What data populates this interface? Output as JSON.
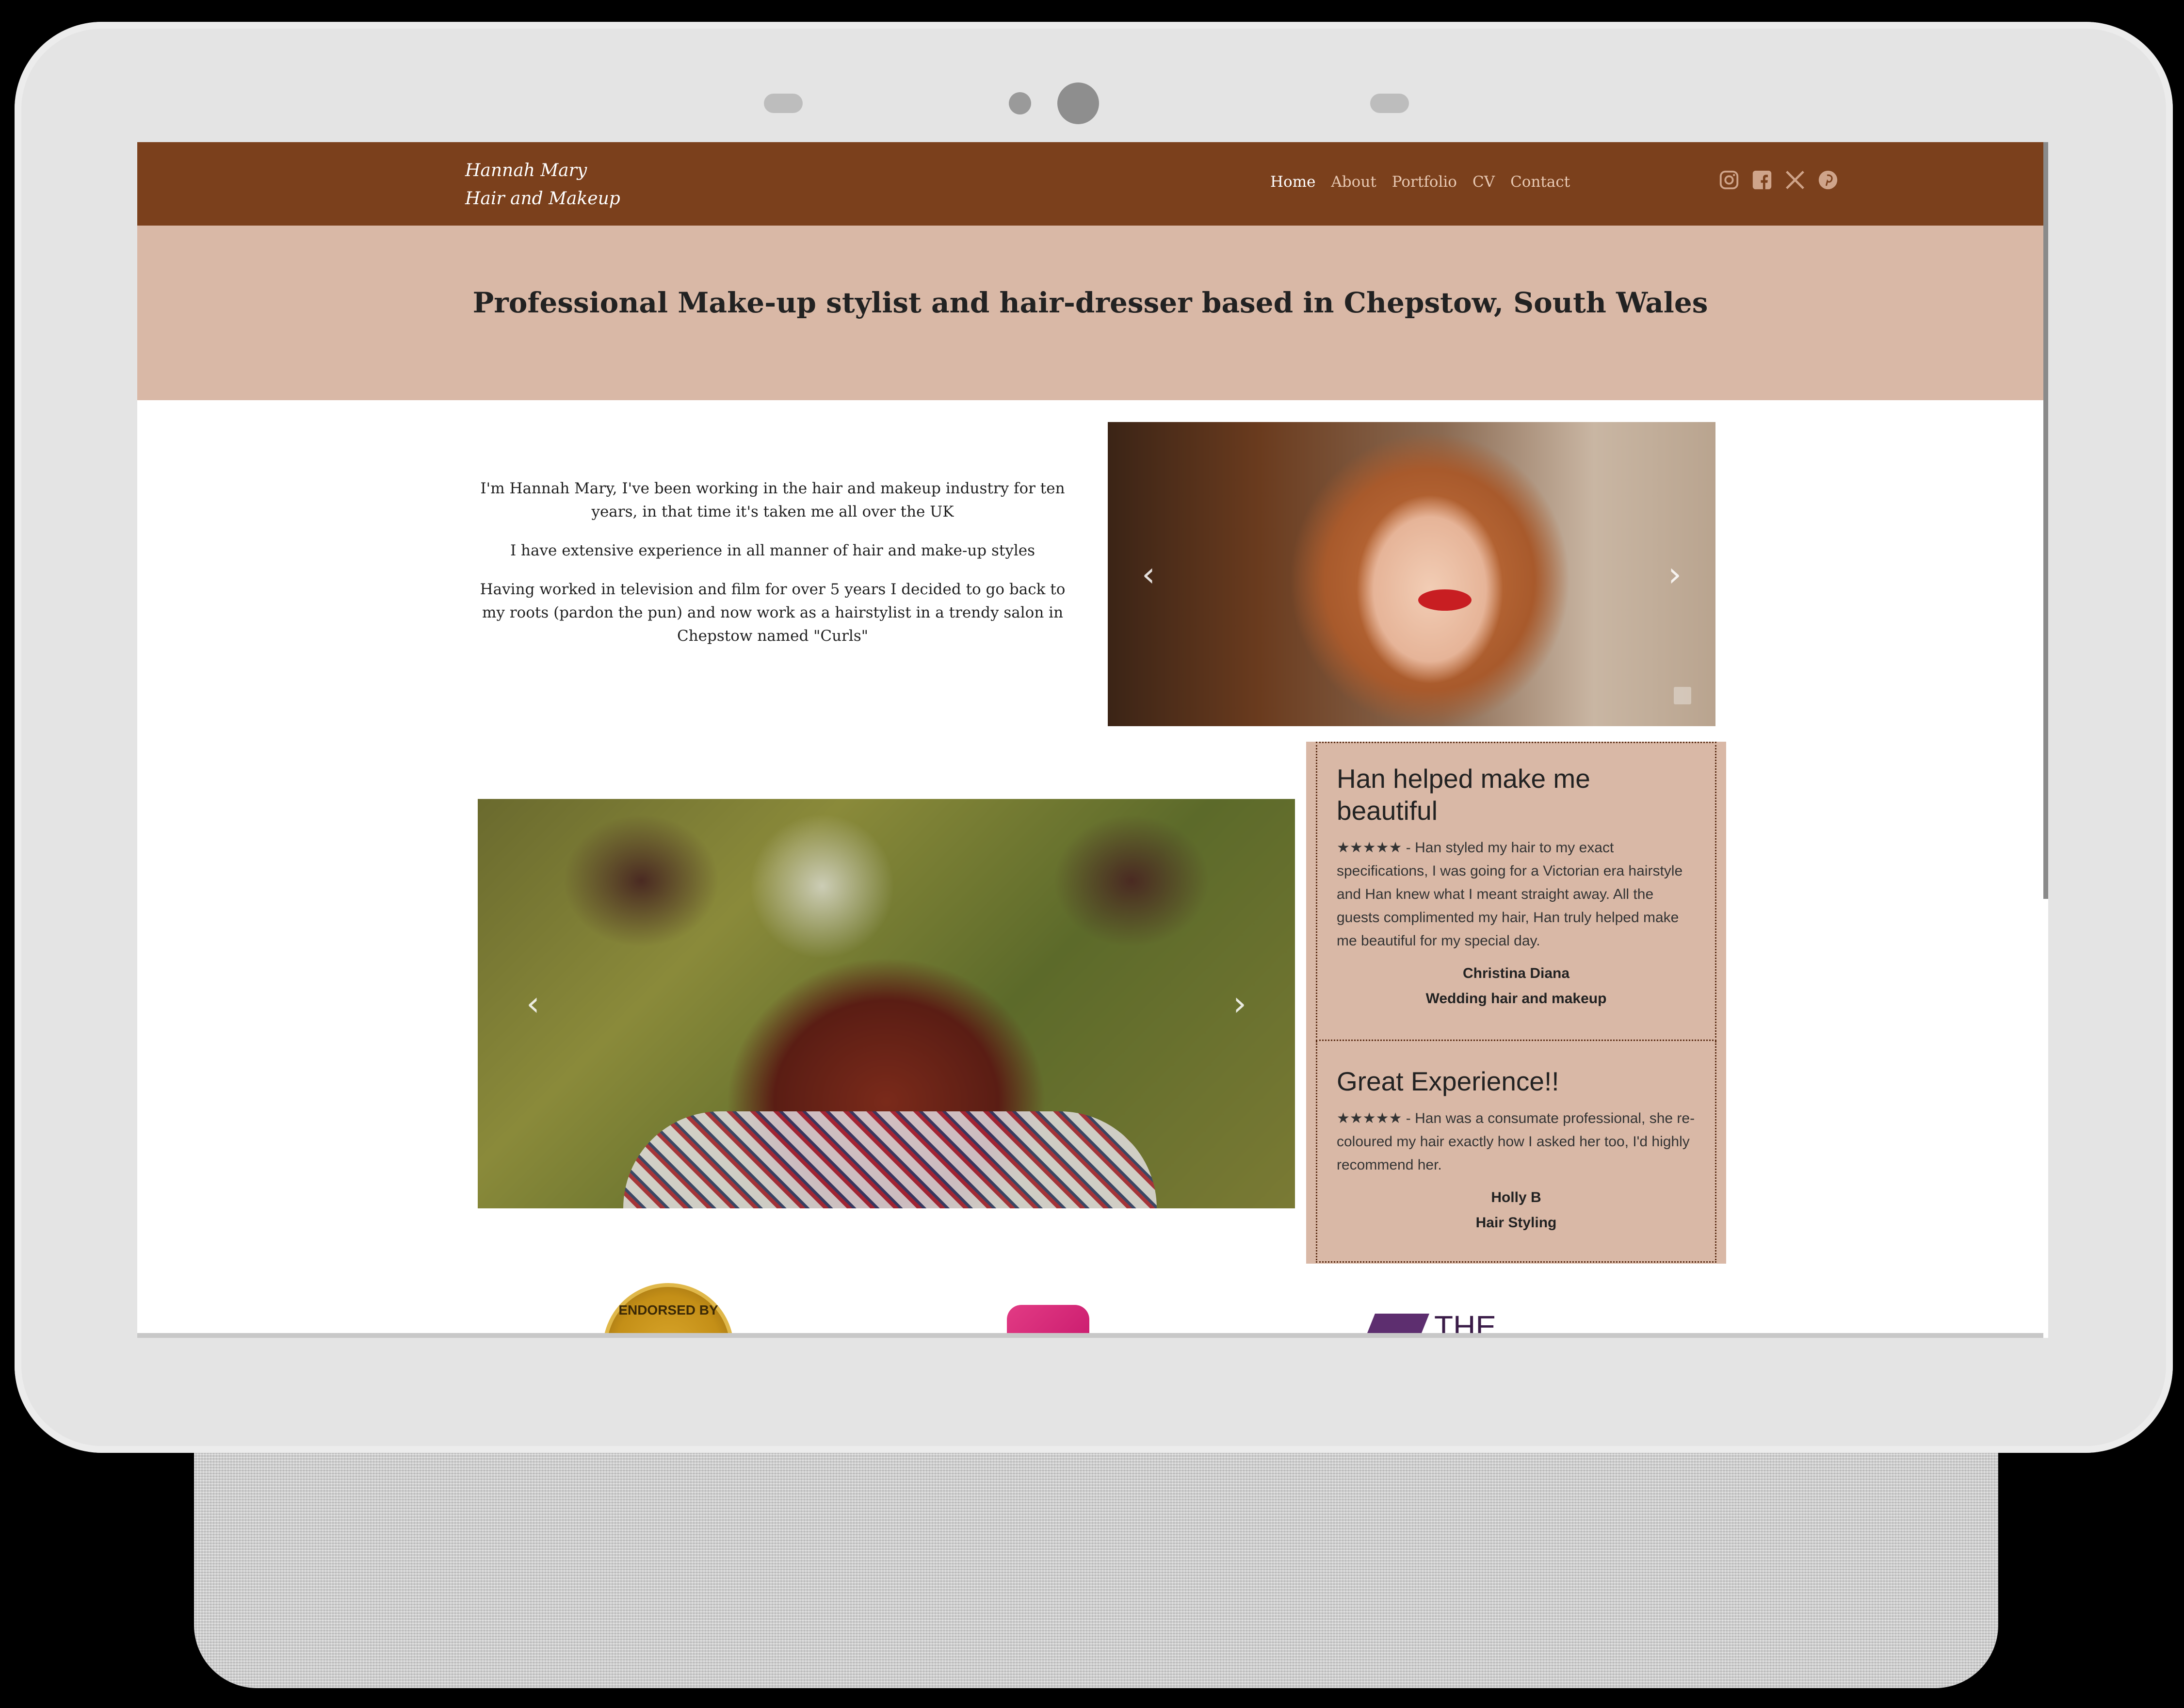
{
  "brand": {
    "line1": "Hannah Mary",
    "line2": "Hair and Makeup"
  },
  "nav": {
    "items": [
      {
        "label": "Home",
        "active": true
      },
      {
        "label": "About",
        "active": false
      },
      {
        "label": "Portfolio",
        "active": false
      },
      {
        "label": "CV",
        "active": false
      },
      {
        "label": "Contact",
        "active": false
      }
    ],
    "socials": [
      "instagram-icon",
      "facebook-icon",
      "x-icon",
      "pinterest-icon"
    ]
  },
  "hero": {
    "title": "Professional Make-up stylist and hair-dresser based in Chepstow, South Wales"
  },
  "intro": {
    "paragraphs": [
      "I'm Hannah Mary, I've been working in the hair and makeup industry for ten years, in that time it's taken me all over the UK",
      "I have extensive experience in all manner of hair and make-up styles",
      "Having worked in television and film for over 5 years I decided to go back to my roots (pardon the pun) and now work as a hairstylist in a trendy salon in Chepstow named \"Curls\""
    ]
  },
  "carousel": {
    "prev_glyph": "‹",
    "next_glyph": "›"
  },
  "reviews": [
    {
      "title": "Han helped make me beautiful",
      "text": "★★★★★ - Han styled my hair to my exact specifications, I was going for a Victorian era hairstyle and Han knew what I meant straight away. All the guests complimented my hair, Han truly helped make me beautiful for my special day.",
      "author": "Christina Diana",
      "service": "Wedding hair and makeup"
    },
    {
      "title": "Great Experience!!",
      "text": "★★★★★ - Han was a consumate professional, she re-coloured my hair exactly how I asked her too, I'd highly recommend her.",
      "author": "Holly B",
      "service": "Hair Styling"
    }
  ],
  "logos": {
    "endorsed_text": "ENDORSED BY",
    "the_text": "THE"
  },
  "colors": {
    "navbar": "#7b401c",
    "accent_band": "#d9b8a6",
    "nav_link": "#e8c9b3"
  }
}
